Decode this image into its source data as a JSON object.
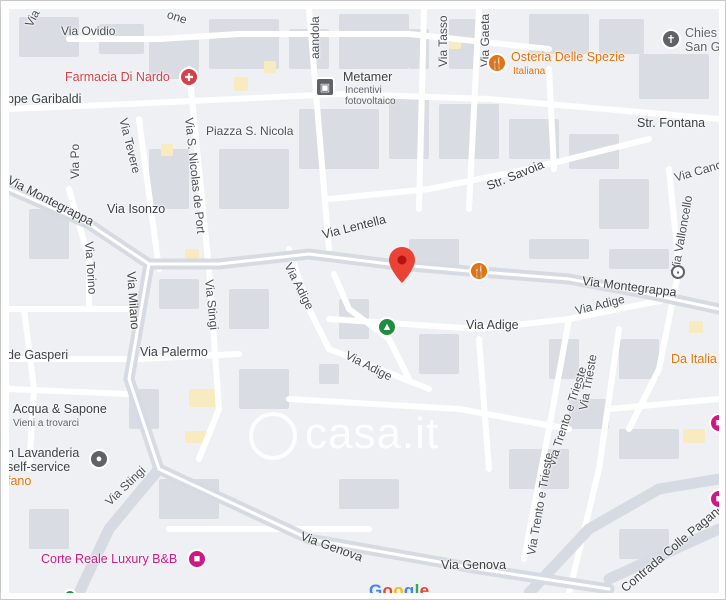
{
  "map": {
    "colors": {
      "background": "#eef0f3",
      "road": "#ffffff",
      "major_road": "#d6dbe3",
      "building": "#d9dde3",
      "highlight_building": "#f8ebbf"
    },
    "streets": {
      "via_omero": "Via Omero",
      "via_ovidio": "Via Ovidio",
      "via_leone_partial": "one",
      "via_baldacchino_partial": "aandola",
      "via_tasso": "Via Tasso",
      "via_gaetano": "Via Gaeta",
      "ppe_garibaldi": "ppe Garibaldi",
      "piazza_s_nicola": "Piazza S. Nicola",
      "str_fontana": "Str. Fontana",
      "str_savoia": "Str. Savoia",
      "via_po": "Via Po",
      "via_tevere": "Via Tevere",
      "via_s_nicolas_de_port": "Via S. Nicolas de Port",
      "via_isonzo": "Via Isonzo",
      "via_lentella": "Via Lentella",
      "via_montegrappa_left": "Via Montegrappa",
      "via_montegrappa_right": "Via Montegrappa",
      "via_torino": "Via Torino",
      "via_milano": "Via Milano",
      "via_stingi_upper": "Via Stingi",
      "via_adige_upper": "Via Adige",
      "via_adige_mid": "Via Adige",
      "via_adige_right": "Via Adige",
      "via_adige_lower": "Via Adige",
      "de_gasperi": "de Gasperi",
      "via_palermo": "Via Palermo",
      "via_trieste": "Via Trieste",
      "via_trento_trieste_upper": "Via Trento e Trieste",
      "via_trento_trieste_lower": "Via Trento e Trieste",
      "via_vallonecello": "Via Valloncello",
      "via_cancello": "Via Canc",
      "via_stingi_lower": "Via Stingi",
      "via_genova_left": "Via Genova",
      "via_genova_right": "Via Genova",
      "contrada_colle_pagano": "Contrada Colle Pagano"
    },
    "pois": {
      "farmacia": {
        "name": "Farmacia Di Nardo",
        "color": "#d93f4a",
        "icon": "pharmacy-icon"
      },
      "metamer": {
        "name": "Metamer",
        "sub1": "Incentivi",
        "sub2": "fotovoltaico",
        "icon": "business-icon"
      },
      "osteria": {
        "name": "Osteria Delle Spezie",
        "sub": "Italiana",
        "color": "#e8710a",
        "icon": "restaurant-icon"
      },
      "chiesa": {
        "name": "Chies",
        "name2": "San G",
        "icon": "church-icon"
      },
      "restaurant_pin": {
        "icon": "restaurant-icon",
        "color": "#e8710a"
      },
      "park_pin": {
        "icon": "tree-icon",
        "color": "#1e8e3e"
      },
      "bus_pin": {
        "icon": "bus-icon"
      },
      "acqua_sapone": {
        "name": "Acqua & Sapone",
        "sub": "Vieni a trovarci",
        "icon": "shop-icon"
      },
      "lavanderia": {
        "name1": "n Lavanderia",
        "name2": "self-service",
        "icon": "shop-icon"
      },
      "fano_partial": {
        "name": "fano",
        "color": "#e8710a"
      },
      "da_italia": {
        "name": "Da Italia",
        "color": "#e8710a"
      },
      "corte_reale": {
        "name": "Corte Reale Luxury B&B",
        "color": "#d01884",
        "icon": "hotel-icon"
      }
    },
    "marker": {
      "icon": "location-pin-icon",
      "color": "#ea4335"
    },
    "watermark": "casa.it",
    "google_logo": "Google"
  }
}
